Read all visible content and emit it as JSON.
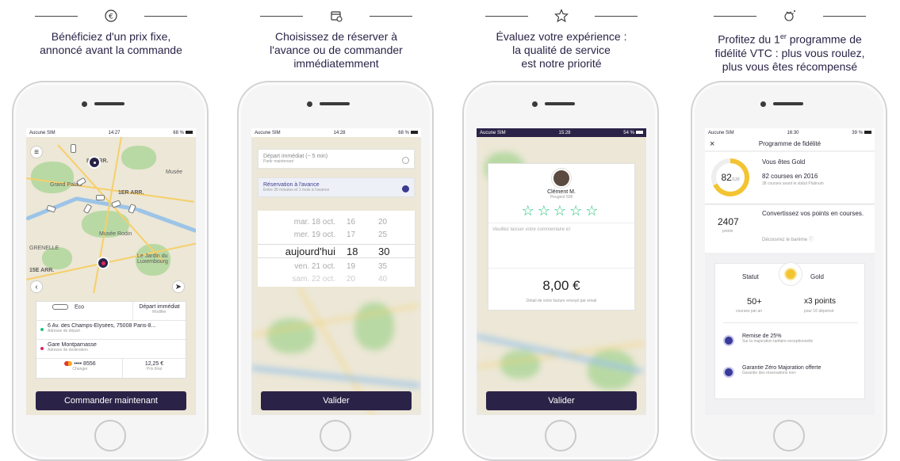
{
  "panels": [
    {
      "icon": "euro-icon",
      "caption": [
        "Bénéficiez d'un prix fixe,",
        "annoncé avant la commande"
      ],
      "status": {
        "carrier": "Aucune SIM",
        "time": "14:27",
        "battery": "68 %"
      },
      "map_labels": [
        "8E ARR.",
        "1ER ARR.",
        "Grand Palais",
        "Musée Rodin",
        "Le Jardin du Luxembourg",
        "15E ARR.",
        "GRENELLE",
        "Musée"
      ],
      "ride": {
        "class": "Eco",
        "timing": "Départ immédiat",
        "timing_sub": "Modifier",
        "from": "6 Av. des Champs-Élysées, 75008 Paris-8...",
        "from_sub": "Adresse de départ",
        "to": "Gare Montparnasse",
        "to_sub": "Adresse de destination",
        "card": "•••• 8556",
        "card_sub": "Changer",
        "price": "12,25 €",
        "price_sub": "Prix final"
      },
      "cta": "Commander maintenant"
    },
    {
      "icon": "calendar-icon",
      "caption": [
        "Choisissez de réserver à",
        "l'avance ou de commander",
        "immédiatemment"
      ],
      "status": {
        "carrier": "Aucune SIM",
        "time": "14:28",
        "battery": "68 %"
      },
      "option_now": "Départ immédiat (~ 5 min)",
      "option_now_sub": "Partir maintenant",
      "option_later": "Réservation à l'avance",
      "option_later_sub": "Entre 30 minutes et 1 mois à l'avance",
      "picker": [
        {
          "day": "mar. 18 oct.",
          "hour": "16",
          "min": "20"
        },
        {
          "day": "mer. 19 oct.",
          "hour": "17",
          "min": "25"
        },
        {
          "day": "aujourd'hui",
          "hour": "18",
          "min": "30"
        },
        {
          "day": "ven. 21 oct.",
          "hour": "19",
          "min": "35"
        },
        {
          "day": "sam. 22 oct.",
          "hour": "20",
          "min": "40"
        }
      ],
      "cta": "Valider"
    },
    {
      "icon": "star-icon",
      "caption": [
        "Évaluez votre expérience :",
        "la qualité de service",
        "est notre priorité"
      ],
      "status": {
        "carrier": "Aucune SIM",
        "time": "15:28",
        "battery": "54 %"
      },
      "driver": "Clément M.",
      "vehicle": "Peugeot 508",
      "stars": "☆☆☆☆☆",
      "comment_placeholder": "Veuillez laisser votre commentaire ici",
      "price": "8,00 €",
      "price_sub": "Détail de votre facture envoyé par email",
      "cta": "Valider"
    },
    {
      "icon": "reward-icon",
      "caption_a": "Profitez du 1",
      "caption_sup": "er",
      "caption_b": " programme de",
      "caption_rest": [
        "fidélité VTC : plus vous roulez,",
        "plus vous êtes récompensé"
      ],
      "status": {
        "carrier": "Aucune SIM",
        "time": "16:30",
        "battery": "39 %"
      },
      "title": "Programme de fidélité",
      "close": "×",
      "ring_value": "82",
      "ring_total": "/120",
      "level_title": "Vous êtes Gold",
      "level_line": "82 courses en 2016",
      "level_sub": "38 courses avant le statut Platinum",
      "points": "2407",
      "points_label": "points",
      "convert": "Convertissez vos points en courses.",
      "convert_link": "Découvrez le barème ⓘ",
      "status_label": "Statut",
      "status_value": "Gold",
      "rides_value": "50+",
      "rides_sub": "courses par an",
      "mult_value": "x3 points",
      "mult_sub": "pour 1€ dépensé",
      "perks": [
        {
          "title": "Remise de 25%",
          "sub": "Sur la majoration tarifaire exceptionnelle"
        },
        {
          "title": "Garantie Zéro Majoration offerte",
          "sub": "Garantie des réservations non-"
        }
      ]
    }
  ],
  "colors": {
    "brand": "#2b2347",
    "accent_green": "#22c27b",
    "gold": "#f3c432",
    "pin": "#e0245e"
  }
}
